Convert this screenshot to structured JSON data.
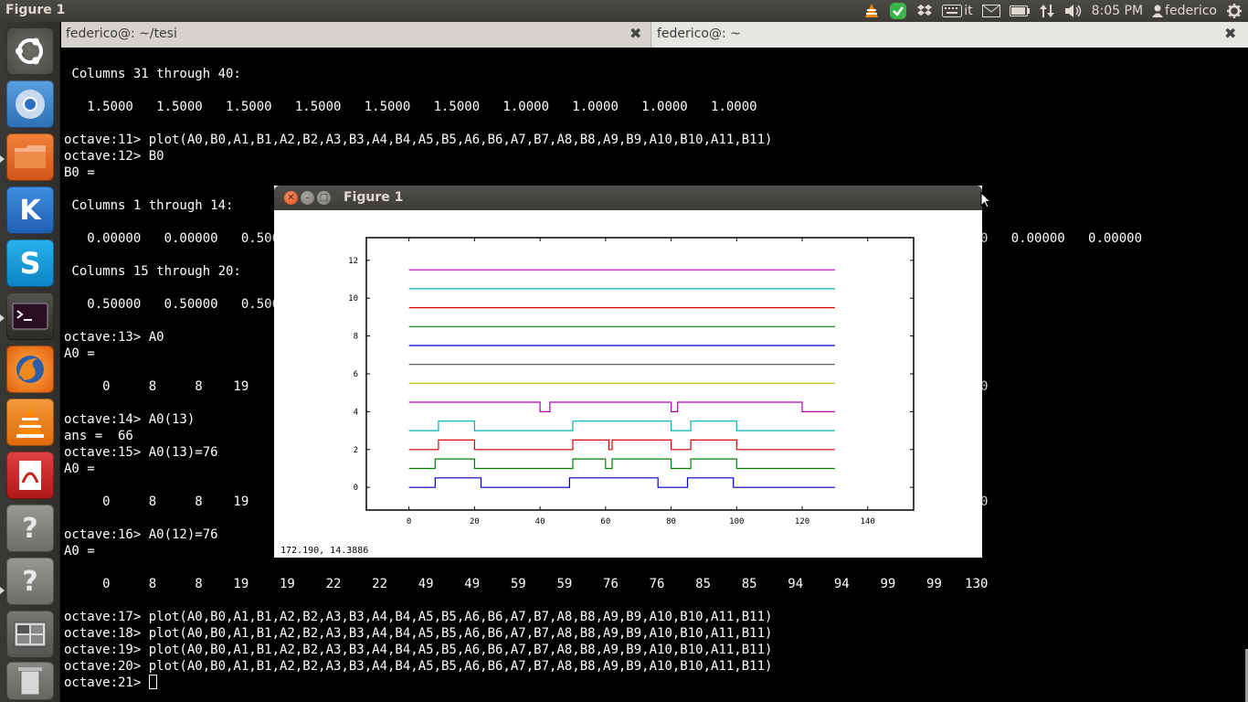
{
  "top_panel": {
    "app_title": "Figure 1",
    "keyboard_layout": "it",
    "time": "8:05 PM",
    "user": "federico"
  },
  "launcher": {
    "items": [
      "dash-home",
      "chromium",
      "files",
      "kile",
      "skype",
      "terminal",
      "firefox",
      "vlc",
      "document-viewer",
      "unknown-app",
      "unknown-app",
      "workspace-switcher",
      "trash"
    ]
  },
  "terminal": {
    "tabs": [
      {
        "title": "federico@: ~/tesi"
      },
      {
        "title": "federico@: ~"
      }
    ],
    "lines": [
      " Columns 31 through 40:",
      "",
      "   1.5000   1.5000   1.5000   1.5000   1.5000   1.5000   1.0000   1.0000   1.0000   1.0000",
      "",
      "octave:11> plot(A0,B0,A1,B1,A2,B2,A3,B3,A4,B4,A5,B5,A6,B6,A7,B7,A8,B8,A9,B9,A10,B10,A11,B11)",
      "octave:12> B0",
      "B0 =",
      "",
      " Columns 1 through 14:",
      "",
      "   0.00000   0.00000   0.50000   0.50000   0.50000   0.50000   0.00000   0.00000   0.00000   0.50000   0.50000   0.50000   0.00000   0.00000",
      "",
      " Columns 15 through 20:",
      "",
      "   0.50000   0.50000   0.50000   0.50000   0.00000   0.00000",
      "",
      "octave:13> A0",
      "A0 =",
      "",
      "     0     8     8    19    19    22    22    49    49    59    59    76    76    85    85    94    94    99    99   130",
      "",
      "octave:14> A0(13)",
      "ans =  66",
      "octave:15> A0(13)=76",
      "A0 =",
      "",
      "     0     8     8    19    19    22    22    49    49    59    59    76    76    85    85    94    94    99    99   130",
      "",
      "octave:16> A0(12)=76",
      "A0 =",
      "",
      "     0     8     8    19    19    22    22    49    49    59    59    76    76    85    85    94    94    99    99   130",
      "",
      "octave:17> plot(A0,B0,A1,B1,A2,B2,A3,B3,A4,B4,A5,B5,A6,B6,A7,B7,A8,B8,A9,B9,A10,B10,A11,B11)",
      "octave:18> plot(A0,B0,A1,B1,A2,B2,A3,B3,A4,B4,A5,B5,A6,B6,A7,B7,A8,B8,A9,B9,A10,B10,A11,B11)",
      "octave:19> plot(A0,B0,A1,B1,A2,B2,A3,B3,A4,B4,A5,B5,A6,B6,A7,B7,A8,B8,A9,B9,A10,B10,A11,B11)",
      "octave:20> plot(A0,B0,A1,B1,A2,B2,A3,B3,A4,B4,A5,B5,A6,B6,A7,B7,A8,B8,A9,B9,A10,B10,A11,B11)",
      "octave:21> "
    ]
  },
  "figure": {
    "title": "Figure 1",
    "coords_readout": "172.190,  14.3886"
  },
  "chart_data": {
    "type": "line",
    "title": "",
    "xlabel": "",
    "ylabel": "",
    "xlim": [
      -13,
      154
    ],
    "ylim": [
      -1.2,
      13.2
    ],
    "xticks": [
      0,
      20,
      40,
      60,
      80,
      100,
      120,
      140
    ],
    "yticks": [
      0,
      2,
      4,
      6,
      8,
      10,
      12
    ],
    "grid": false,
    "legend": "none",
    "series": [
      {
        "color": "#0000c8",
        "x": [
          0,
          8,
          8,
          22,
          22,
          49,
          49,
          76,
          76,
          85,
          85,
          99,
          99,
          130
        ],
        "y": [
          0,
          0,
          0.5,
          0.5,
          0,
          0,
          0.5,
          0.5,
          0,
          0,
          0.5,
          0.5,
          0,
          0
        ]
      },
      {
        "color": "#008000",
        "x": [
          0,
          8,
          8,
          20,
          20,
          50,
          50,
          60,
          60,
          62,
          62,
          80,
          80,
          86,
          86,
          100,
          100,
          130
        ],
        "y": [
          1,
          1,
          1.5,
          1.5,
          1,
          1,
          1.5,
          1.5,
          1,
          1,
          1.5,
          1.5,
          1,
          1,
          1.5,
          1.5,
          1,
          1
        ]
      },
      {
        "color": "#e00000",
        "x": [
          0,
          9,
          9,
          20,
          20,
          50,
          50,
          61,
          61,
          62,
          62,
          80,
          80,
          86,
          86,
          100,
          100,
          130
        ],
        "y": [
          2,
          2,
          2.5,
          2.5,
          2,
          2,
          2.5,
          2.5,
          2,
          2,
          2.5,
          2.5,
          2,
          2,
          2.5,
          2.5,
          2,
          2
        ]
      },
      {
        "color": "#00b0b0",
        "x": [
          0,
          9,
          9,
          20,
          20,
          50,
          50,
          80,
          80,
          86,
          86,
          100,
          100,
          130
        ],
        "y": [
          3,
          3,
          3.5,
          3.5,
          3,
          3,
          3.5,
          3.5,
          3,
          3,
          3.5,
          3.5,
          3,
          3
        ]
      },
      {
        "color": "#b000b0",
        "x": [
          0,
          40,
          40,
          43,
          43,
          80,
          80,
          82,
          82,
          120,
          120,
          130
        ],
        "y": [
          4.5,
          4.5,
          4,
          4,
          4.5,
          4.5,
          4,
          4,
          4.5,
          4.5,
          4,
          4
        ]
      },
      {
        "color": "#c0b000",
        "x": [
          0,
          130
        ],
        "y": [
          5.5,
          5.5
        ]
      },
      {
        "color": "#505050",
        "x": [
          0,
          130
        ],
        "y": [
          6.5,
          6.5
        ]
      },
      {
        "color": "#0000c8",
        "x": [
          0,
          130
        ],
        "y": [
          7.5,
          7.5
        ]
      },
      {
        "color": "#008000",
        "x": [
          0,
          130
        ],
        "y": [
          8.5,
          8.5
        ]
      },
      {
        "color": "#e00000",
        "x": [
          0,
          130
        ],
        "y": [
          9.5,
          9.5
        ]
      },
      {
        "color": "#00b0b0",
        "x": [
          0,
          130
        ],
        "y": [
          10.5,
          10.5
        ]
      },
      {
        "color": "#b000b0",
        "x": [
          0,
          130
        ],
        "y": [
          11.5,
          11.5
        ]
      }
    ]
  },
  "colors": {
    "panel": "#3c3b37",
    "launcher": "#33312d",
    "terminal_bg": "#000000",
    "terminal_fg": "#ffffff",
    "close_button": "#dd4814"
  }
}
